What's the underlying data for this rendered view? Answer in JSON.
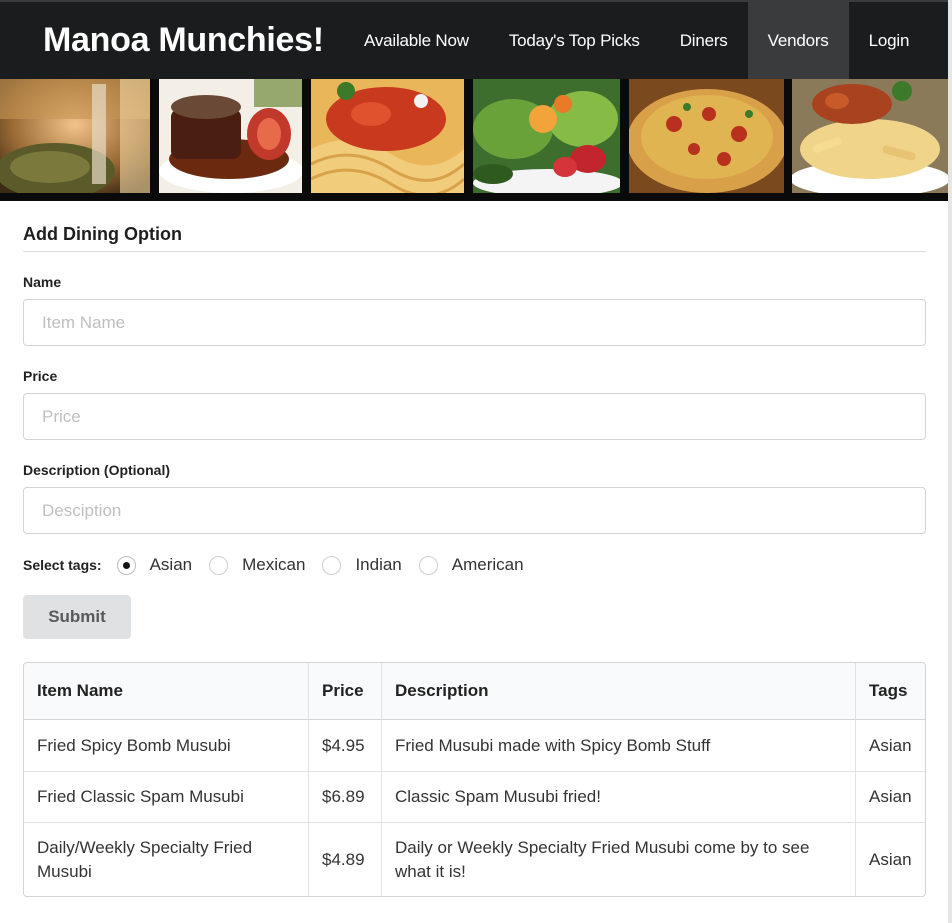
{
  "navbar": {
    "brand": "Manoa Munchies!",
    "items": [
      {
        "label": "Available Now",
        "active": false
      },
      {
        "label": "Today's Top Picks",
        "active": false
      },
      {
        "label": "Diners",
        "active": false
      },
      {
        "label": "Vendors",
        "active": true
      },
      {
        "label": "Login",
        "active": false
      }
    ]
  },
  "banner": {
    "tiles": [
      "wine-glass-photo",
      "steak-photo",
      "spaghetti-photo",
      "salad-photo",
      "pizza-photo",
      "penne-photo"
    ]
  },
  "form": {
    "title": "Add Dining Option",
    "name_label": "Name",
    "name_placeholder": "Item Name",
    "price_label": "Price",
    "price_placeholder": "Price",
    "description_label": "Description (Optional)",
    "description_placeholder": "Desciption",
    "tags_label": "Select tags:",
    "tags": [
      {
        "label": "Asian",
        "checked": true
      },
      {
        "label": "Mexican",
        "checked": false
      },
      {
        "label": "Indian",
        "checked": false
      },
      {
        "label": "American",
        "checked": false
      }
    ],
    "submit_label": "Submit"
  },
  "table": {
    "headers": [
      "Item Name",
      "Price",
      "Description",
      "Tags"
    ],
    "rows": [
      [
        "Fried Spicy Bomb Musubi",
        "$4.95",
        "Fried Musubi made with Spicy Bomb Stuff",
        "Asian"
      ],
      [
        "Fried Classic Spam Musubi",
        "$6.89",
        "Classic Spam Musubi fried!",
        "Asian"
      ],
      [
        "Daily/Weekly Specialty Fried Musubi",
        "$4.89",
        "Daily or Weekly Specialty Fried Musubi come by to see what it is!",
        "Asian"
      ]
    ]
  }
}
